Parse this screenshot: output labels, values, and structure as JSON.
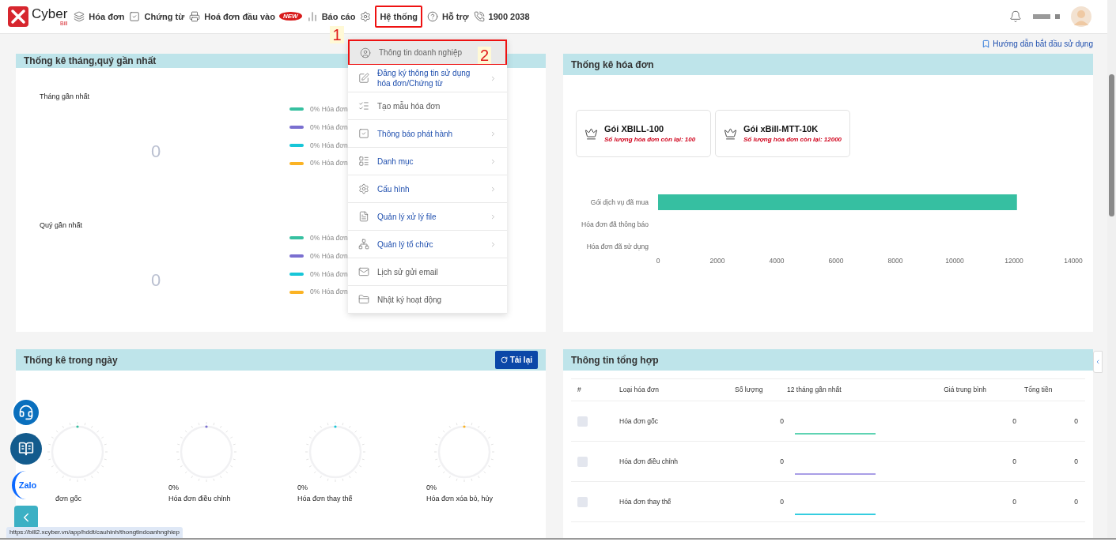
{
  "logo": {
    "name": "Cyber",
    "sub": "Bill"
  },
  "nav": [
    {
      "label": "Hóa đơn",
      "selected": false
    },
    {
      "label": "Chứng từ",
      "selected": false
    },
    {
      "label": "Hoá đơn đầu vào",
      "selected": false,
      "badge": "NEW"
    },
    {
      "label": "Báo cáo",
      "selected": false
    },
    {
      "label": "Hệ thống",
      "selected": true,
      "callout": "1"
    },
    {
      "label": "Hỗ trợ",
      "selected": false
    },
    {
      "label": "1900 2038",
      "selected": false
    }
  ],
  "menu": [
    {
      "label": "Thông tin doanh nghiệp",
      "has_submenu": false,
      "selected": true,
      "callout": "2"
    },
    {
      "label": "Đăng ký thông tin sử dụng hóa đơn/Chứng từ",
      "has_submenu": true,
      "selected": false
    },
    {
      "label": "Tạo mẫu hóa đơn",
      "has_submenu": false,
      "selected": false
    },
    {
      "label": "Thông báo phát hành",
      "has_submenu": true,
      "selected": false
    },
    {
      "label": "Danh mục",
      "has_submenu": true,
      "selected": false
    },
    {
      "label": "Cấu hình",
      "has_submenu": true,
      "selected": false
    },
    {
      "label": "Quản lý xử lý file",
      "has_submenu": true,
      "selected": false
    },
    {
      "label": "Quản lý tổ chức",
      "has_submenu": true,
      "selected": false
    },
    {
      "label": "Lịch sử gửi email",
      "has_submenu": false,
      "selected": false
    },
    {
      "label": "Nhật ký hoạt động",
      "has_submenu": false,
      "selected": false
    }
  ],
  "guide_link": "Hướng dẫn bắt đầu sử dụng",
  "period_panel": {
    "title": "Thống kê tháng,quý gần nhất",
    "sections": [
      {
        "label": "Tháng gần nhất",
        "total": "0",
        "legend": [
          {
            "text": "0% Hóa đơn",
            "color": "#36c0a0"
          },
          {
            "text": "0% Hóa đơn",
            "color": "#7a6fd0"
          },
          {
            "text": "0% Hóa đơn",
            "color": "#17c6d8"
          },
          {
            "text": "0% Hóa đơn",
            "color": "#fbb324"
          }
        ]
      },
      {
        "label": "Quý gần nhất",
        "total": "0",
        "legend": [
          {
            "text": "0% Hóa đơn",
            "color": "#36c0a0"
          },
          {
            "text": "0% Hóa đơn",
            "color": "#7a6fd0"
          },
          {
            "text": "0% Hóa đơn",
            "color": "#17c6d8"
          },
          {
            "text": "0% Hóa đơn",
            "color": "#fbb324"
          }
        ]
      }
    ]
  },
  "invoice_panel": {
    "title": "Thống kê hóa đơn",
    "packages": [
      {
        "name": "Gói XBILL-100",
        "remaining": "Số lượng hóa đơn còn lại: 100"
      },
      {
        "name": "Gói xBill-MTT-10K",
        "remaining": "Số lượng hóa đơn còn lại: 12000"
      }
    ],
    "chart_data": {
      "type": "bar",
      "orientation": "horizontal",
      "categories": [
        "Gói dịch vụ đã mua",
        "Hóa đơn đã thông báo",
        "Hóa đơn đã sử dụng"
      ],
      "series": [
        {
          "color": "#36bfa1",
          "values": [
            12100,
            0,
            0
          ]
        }
      ],
      "xlim": [
        0,
        14000
      ],
      "xticks": [
        0,
        2000,
        4000,
        6000,
        8000,
        10000,
        12000,
        14000
      ]
    }
  },
  "daily_panel": {
    "title": "Thống kê trong ngày",
    "reload": "Tải lại",
    "gauges": [
      {
        "label": "đơn gốc",
        "color": "#36c0a0"
      },
      {
        "value": "0%",
        "label": "Hóa đơn điều chỉnh",
        "color": "#7a6fd0"
      },
      {
        "value": "0%",
        "label": "Hóa đơn thay thế",
        "color": "#17c6d8"
      },
      {
        "value": "0%",
        "label": "Hóa đơn xóa bỏ, hủy",
        "color": "#fbb324"
      }
    ]
  },
  "summary_panel": {
    "title": "Thông tin tổng hợp",
    "columns": [
      "#",
      "Loại hóa đơn",
      "Số lượng",
      "12 tháng gần nhất",
      "Giá trung bình",
      "Tổng tiền"
    ],
    "rows": [
      {
        "type": "Hóa đơn gốc",
        "quantity": "0",
        "color": "#5fd3b3",
        "average": "0",
        "total": "0",
        "checked": false
      },
      {
        "type": "Hóa đơn điều chỉnh",
        "quantity": "0",
        "color": "#a99ee6",
        "average": "0",
        "total": "0",
        "checked": false
      },
      {
        "type": "Hóa đơn thay thế",
        "quantity": "0",
        "color": "#35cde0",
        "average": "0",
        "total": "0",
        "checked": false
      }
    ]
  },
  "floating": {
    "zalo": "Zalo"
  },
  "status_url": "https://bill2.xcyber.vn/app/hddt/cauhinh/thongtindoanhnghiep"
}
